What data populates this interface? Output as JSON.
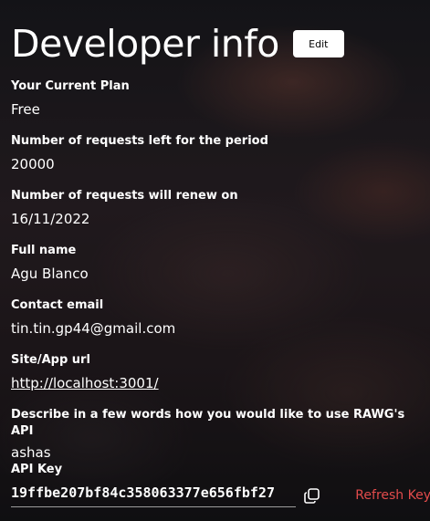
{
  "header": {
    "title": "Developer info",
    "edit_label": "Edit"
  },
  "fields": [
    {
      "label": "Your Current Plan",
      "value": "Free"
    },
    {
      "label": "Number of requests left for the period",
      "value": "20000"
    },
    {
      "label": "Number of requests will renew on",
      "value": "16/11/2022"
    },
    {
      "label": "Full name",
      "value": "Agu Blanco"
    },
    {
      "label": "Contact email",
      "value": "tin.tin.gp44@gmail.com"
    },
    {
      "label": "Site/App url",
      "value": "http://localhost:3001/"
    },
    {
      "label": "Describe in a few words how you would like to use RAWG's API",
      "value": "ashas"
    }
  ],
  "api_key": {
    "label": "API Key",
    "value": "19ffbe207bf84c358063377e656fbf27",
    "refresh_label": "Refresh Key",
    "copy_icon": "copy-icon"
  },
  "colors": {
    "refresh": "#e24b4b",
    "text": "#ffffff",
    "button_bg": "#ffffff"
  }
}
